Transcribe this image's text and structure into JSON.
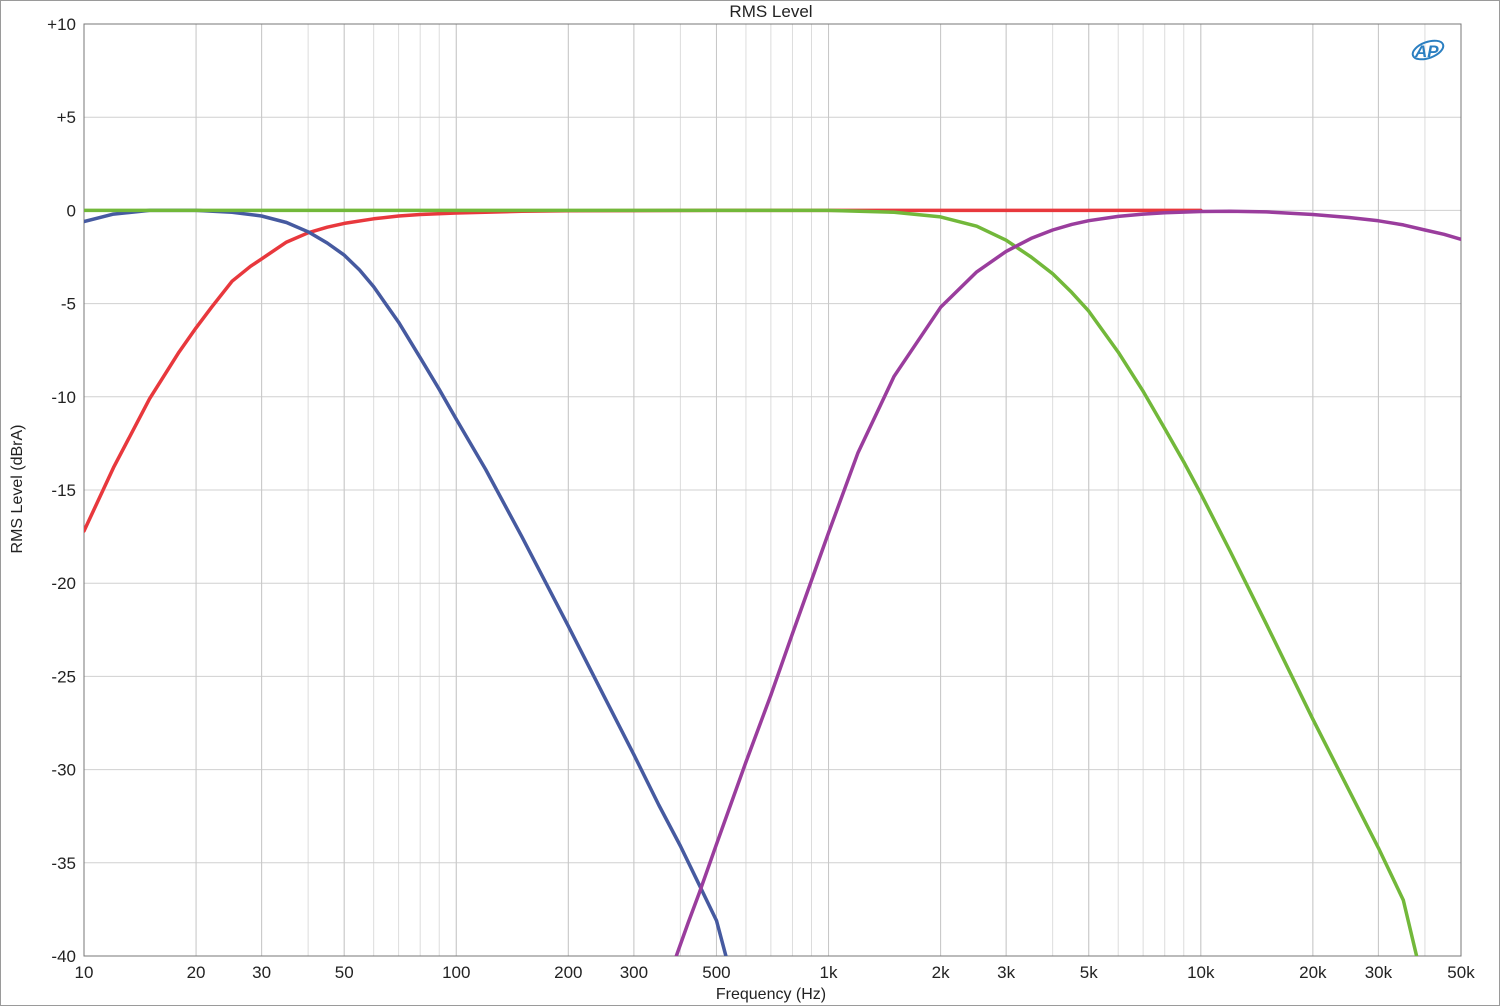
{
  "chart_data": {
    "type": "line",
    "title": "RMS Level",
    "xlabel": "Frequency (Hz)",
    "ylabel": "RMS Level (dBrA)",
    "x_scale": "log",
    "xlim": [
      10,
      50000
    ],
    "ylim": [
      -40,
      10
    ],
    "grid": true,
    "legend": "none",
    "logo": "AP",
    "x_ticks": [
      {
        "value": 10,
        "label": "10"
      },
      {
        "value": 20,
        "label": "20"
      },
      {
        "value": 30,
        "label": "30"
      },
      {
        "value": 50,
        "label": "50"
      },
      {
        "value": 100,
        "label": "100"
      },
      {
        "value": 200,
        "label": "200"
      },
      {
        "value": 300,
        "label": "300"
      },
      {
        "value": 500,
        "label": "500"
      },
      {
        "value": 1000,
        "label": "1k"
      },
      {
        "value": 2000,
        "label": "2k"
      },
      {
        "value": 3000,
        "label": "3k"
      },
      {
        "value": 5000,
        "label": "5k"
      },
      {
        "value": 10000,
        "label": "10k"
      },
      {
        "value": 20000,
        "label": "20k"
      },
      {
        "value": 30000,
        "label": "30k"
      },
      {
        "value": 50000,
        "label": "50k"
      }
    ],
    "y_ticks": [
      {
        "value": 10,
        "label": "+10"
      },
      {
        "value": 5,
        "label": "+5"
      },
      {
        "value": 0,
        "label": "0"
      },
      {
        "value": -5,
        "label": "-5"
      },
      {
        "value": -10,
        "label": "-10"
      },
      {
        "value": -15,
        "label": "-15"
      },
      {
        "value": -20,
        "label": "-20"
      },
      {
        "value": -25,
        "label": "-25"
      },
      {
        "value": -30,
        "label": "-30"
      },
      {
        "value": -35,
        "label": "-35"
      },
      {
        "value": -40,
        "label": "-40"
      }
    ],
    "series": [
      {
        "color": "#e8383d",
        "x": [
          10,
          12,
          15,
          18,
          20,
          22,
          25,
          28,
          30,
          35,
          40,
          45,
          50,
          60,
          70,
          80,
          100,
          150,
          200,
          500,
          1000,
          2000,
          5000,
          10000
        ],
        "y": [
          -17.2,
          -13.8,
          -10.1,
          -7.6,
          -6.3,
          -5.2,
          -3.8,
          -3.0,
          -2.6,
          -1.7,
          -1.2,
          -0.9,
          -0.7,
          -0.45,
          -0.3,
          -0.22,
          -0.14,
          -0.05,
          -0.02,
          0,
          0,
          0,
          0,
          0
        ]
      },
      {
        "color": "#465aa0",
        "x": [
          10,
          12,
          15,
          18,
          20,
          25,
          30,
          35,
          40,
          45,
          50,
          55,
          60,
          70,
          80,
          90,
          100,
          120,
          150,
          200,
          250,
          300,
          350,
          400,
          450,
          500,
          530
        ],
        "y": [
          -0.6,
          -0.2,
          0,
          0,
          0,
          -0.1,
          -0.3,
          -0.65,
          -1.15,
          -1.75,
          -2.4,
          -3.2,
          -4.1,
          -6.0,
          -7.9,
          -9.6,
          -11.2,
          -13.9,
          -17.5,
          -22.3,
          -26.1,
          -29.2,
          -31.9,
          -34.1,
          -36.2,
          -38.1,
          -40
        ]
      },
      {
        "color": "#72b83a",
        "x": [
          10,
          15,
          20,
          50,
          100,
          200,
          500,
          1000,
          1500,
          2000,
          2500,
          3000,
          3500,
          4000,
          4500,
          5000,
          6000,
          7000,
          8000,
          9000,
          10000,
          12000,
          15000,
          20000,
          25000,
          30000,
          35000,
          38000
        ],
        "y": [
          0,
          0,
          0,
          0,
          0,
          0,
          0,
          0,
          -0.1,
          -0.35,
          -0.85,
          -1.6,
          -2.5,
          -3.4,
          -4.4,
          -5.4,
          -7.6,
          -9.7,
          -11.7,
          -13.5,
          -15.2,
          -18.3,
          -22.2,
          -27.3,
          -31.1,
          -34.2,
          -37.0,
          -40
        ]
      },
      {
        "color": "#9a3d9d",
        "x": [
          390,
          420,
          450,
          500,
          600,
          700,
          800,
          1000,
          1200,
          1500,
          2000,
          2500,
          3000,
          3500,
          4000,
          4500,
          5000,
          6000,
          7000,
          8000,
          10000,
          12000,
          15000,
          20000,
          25000,
          30000,
          35000,
          40000,
          45000,
          50000
        ],
        "y": [
          -40,
          -38.2,
          -36.6,
          -34.0,
          -29.6,
          -26.0,
          -22.7,
          -17.3,
          -13.0,
          -8.9,
          -5.2,
          -3.3,
          -2.2,
          -1.5,
          -1.05,
          -0.75,
          -0.55,
          -0.32,
          -0.2,
          -0.13,
          -0.06,
          -0.05,
          -0.08,
          -0.22,
          -0.38,
          -0.56,
          -0.78,
          -1.05,
          -1.28,
          -1.55
        ]
      }
    ]
  }
}
